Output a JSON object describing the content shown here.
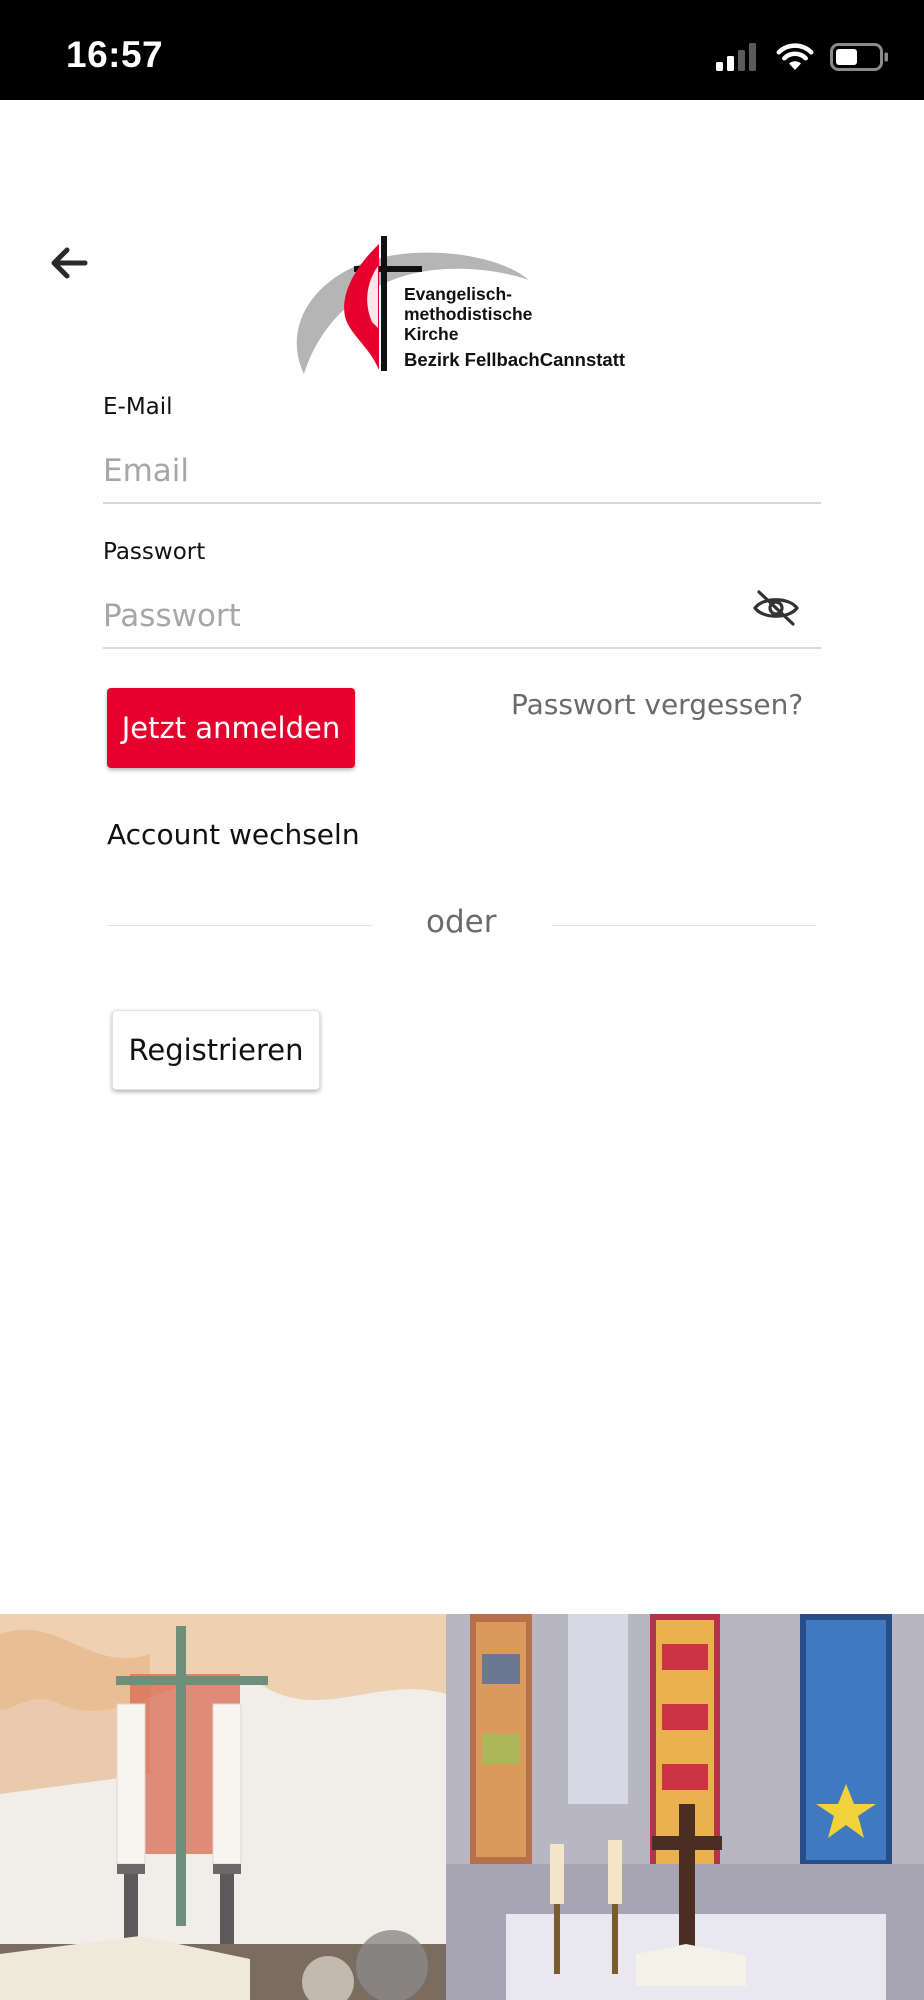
{
  "status_bar": {
    "time": "16:57",
    "icons": [
      "signal-icon",
      "wifi-icon",
      "battery-icon"
    ]
  },
  "header": {
    "back_icon": "arrow-left-icon",
    "logo": {
      "line1": "Evangelisch-",
      "line2": "methodistische",
      "line3": "Kirche",
      "district": "Bezirk FellbachCannstatt"
    }
  },
  "form": {
    "email": {
      "label": "E-Mail",
      "placeholder": "Email",
      "value": ""
    },
    "password": {
      "label": "Passwort",
      "placeholder": "Passwort",
      "value": "",
      "toggle_icon": "eye-slash-icon"
    }
  },
  "actions": {
    "login_label": "Jetzt anmelden",
    "forgot_password_label": "Passwort vergessen?",
    "switch_account_label": "Account wechseln",
    "divider_label": "oder",
    "register_label": "Registrieren"
  },
  "images": {
    "left": "altar-with-candles-and-cross",
    "right": "church-interior-with-stained-glass-windows"
  },
  "colors": {
    "accent": "#e6002d",
    "logo_grey": "#b5b5b5",
    "status_bar": "#000000"
  }
}
